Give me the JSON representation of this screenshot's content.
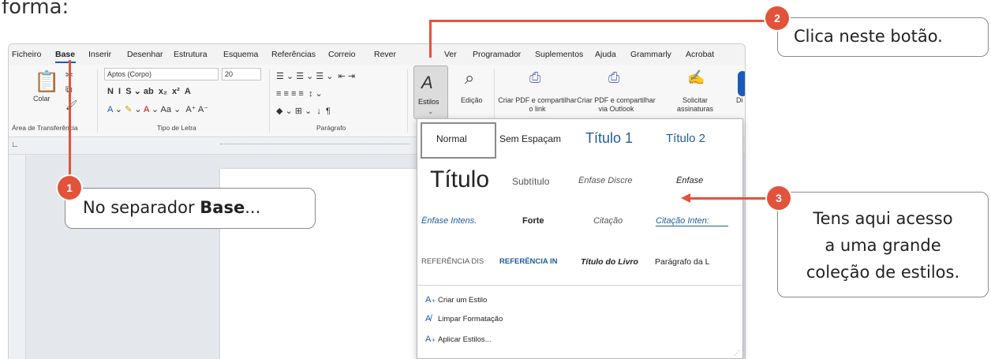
{
  "intro": {
    "text": "forma:"
  },
  "menu": {
    "items": [
      "Ficheiro",
      "Base",
      "Inserir",
      "Desenhar",
      "Estrutura",
      "Esquema",
      "Referências",
      "Correio",
      "Rever",
      "Ver",
      "Programador",
      "Suplementos",
      "Ajuda",
      "Grammarly",
      "Acrobat"
    ],
    "active": "Base"
  },
  "ribbon": {
    "clipboard": {
      "paste_label": "Colar",
      "group_label": "Área de Transferência"
    },
    "font": {
      "name": "Aptos (Corpo)",
      "size": "20",
      "group_label": "Tipo de Letra"
    },
    "paragraph": {
      "group_label": "Parágrafo"
    },
    "styles": {
      "label": "Estilos"
    },
    "editing": {
      "label": "Edição"
    },
    "acrobat": {
      "pdf_link_label": "Criar PDF e compartilhar o link",
      "pdf_outlook_label": "Criar PDF e compartilhar via Outlook",
      "signatures_label": "Solicitar assinaturas"
    },
    "dictate_label": "Di"
  },
  "styles_gallery": {
    "rows": [
      [
        "Normal",
        "Sem Espaçam",
        "Título 1",
        "Título 2"
      ],
      [
        "Título",
        "Subtítulo",
        "Ênfase Discre",
        "Ênfase"
      ],
      [
        "Ênfase Intens.",
        "Forte",
        "Citação",
        "Citação Inten:"
      ],
      [
        "REFERÊNCIA DIS",
        "REFERÊNCIA IN",
        "Título do Livro",
        "Parágrafo da L"
      ]
    ],
    "commands": [
      "Criar um Estilo",
      "Limpar Formatação",
      "Aplicar Estilos..."
    ]
  },
  "callouts": {
    "step1": {
      "number": "1",
      "text_prefix": "No separador ",
      "text_bold": "Base",
      "text_suffix": "..."
    },
    "step2": {
      "number": "2",
      "text": "Clica neste botão."
    },
    "step3": {
      "number": "3",
      "line1": "Tens aqui acesso",
      "line2": "a uma grande",
      "line3": "coleção de estilos."
    }
  },
  "colors": {
    "accent": "#e2533b",
    "word_blue": "#185abd",
    "heading_blue": "#1e5c9b"
  }
}
